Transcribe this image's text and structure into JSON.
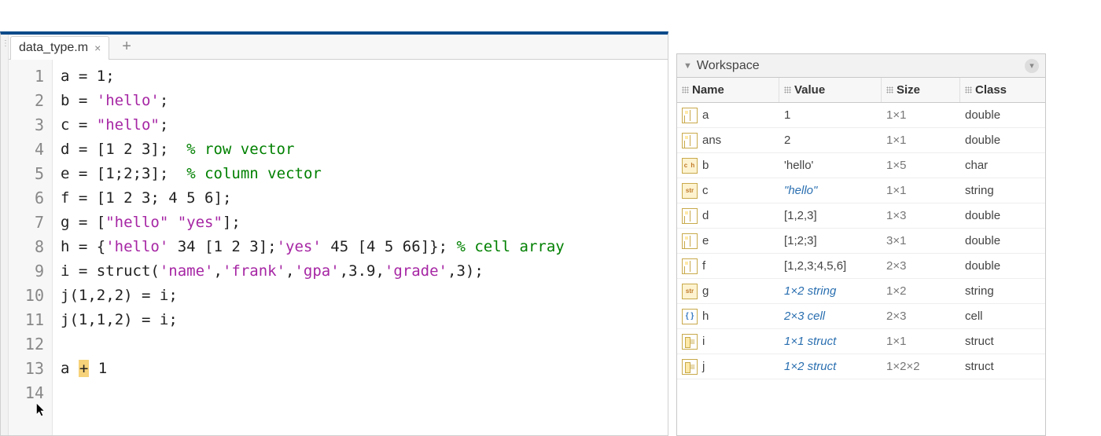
{
  "editor": {
    "tab_name": "data_type.m",
    "lines": [
      [
        {
          "t": "a = "
        },
        {
          "t": "1",
          "c": "s-num"
        },
        {
          "t": ";"
        }
      ],
      [
        {
          "t": "b = "
        },
        {
          "t": "'hello'",
          "c": "s-str1"
        },
        {
          "t": ";"
        }
      ],
      [
        {
          "t": "c = "
        },
        {
          "t": "\"hello\"",
          "c": "s-str2"
        },
        {
          "t": ";"
        }
      ],
      [
        {
          "t": "d = ["
        },
        {
          "t": "1 2 3",
          "c": "s-num"
        },
        {
          "t": "];  "
        },
        {
          "t": "% row vector",
          "c": "s-cmt"
        }
      ],
      [
        {
          "t": "e = ["
        },
        {
          "t": "1",
          "c": "s-num"
        },
        {
          "t": ";"
        },
        {
          "t": "2",
          "c": "s-num"
        },
        {
          "t": ";"
        },
        {
          "t": "3",
          "c": "s-num"
        },
        {
          "t": "];  "
        },
        {
          "t": "% column vector",
          "c": "s-cmt"
        }
      ],
      [
        {
          "t": "f = ["
        },
        {
          "t": "1 2 3",
          "c": "s-num"
        },
        {
          "t": "; "
        },
        {
          "t": "4 5 6",
          "c": "s-num"
        },
        {
          "t": "];"
        }
      ],
      [
        {
          "t": "g = ["
        },
        {
          "t": "\"hello\" \"yes\"",
          "c": "s-str2"
        },
        {
          "t": "];"
        }
      ],
      [
        {
          "t": "h = {"
        },
        {
          "t": "'hello'",
          "c": "s-str1"
        },
        {
          "t": " "
        },
        {
          "t": "34",
          "c": "s-num"
        },
        {
          "t": " ["
        },
        {
          "t": "1 2 3",
          "c": "s-num"
        },
        {
          "t": "];"
        },
        {
          "t": "'yes'",
          "c": "s-str1"
        },
        {
          "t": " "
        },
        {
          "t": "45",
          "c": "s-num"
        },
        {
          "t": " ["
        },
        {
          "t": "4 5 66",
          "c": "s-num"
        },
        {
          "t": "]}; "
        },
        {
          "t": "% cell array",
          "c": "s-cmt"
        }
      ],
      [
        {
          "t": "i = struct("
        },
        {
          "t": "'name'",
          "c": "s-str1"
        },
        {
          "t": ","
        },
        {
          "t": "'frank'",
          "c": "s-str1"
        },
        {
          "t": ","
        },
        {
          "t": "'gpa'",
          "c": "s-str1"
        },
        {
          "t": ","
        },
        {
          "t": "3.9",
          "c": "s-num"
        },
        {
          "t": ","
        },
        {
          "t": "'grade'",
          "c": "s-str1"
        },
        {
          "t": ","
        },
        {
          "t": "3",
          "c": "s-num"
        },
        {
          "t": ");"
        }
      ],
      [
        {
          "t": "j("
        },
        {
          "t": "1",
          "c": "s-num"
        },
        {
          "t": ","
        },
        {
          "t": "2",
          "c": "s-num"
        },
        {
          "t": ","
        },
        {
          "t": "2",
          "c": "s-num"
        },
        {
          "t": ") = i;"
        }
      ],
      [
        {
          "t": "j("
        },
        {
          "t": "1",
          "c": "s-num"
        },
        {
          "t": ","
        },
        {
          "t": "1",
          "c": "s-num"
        },
        {
          "t": ","
        },
        {
          "t": "2",
          "c": "s-num"
        },
        {
          "t": ") = i;"
        }
      ],
      [],
      [
        {
          "t": "a "
        },
        {
          "t": "+",
          "c": "s-cursor"
        },
        {
          "t": " 1"
        }
      ],
      []
    ],
    "line_count": 14
  },
  "workspace": {
    "title": "Workspace",
    "columns": [
      "Name",
      "Value",
      "Size",
      "Class"
    ],
    "rows": [
      {
        "name": "a",
        "icon": "double",
        "value": "1",
        "value_style": "",
        "size": "1×1",
        "class": "double"
      },
      {
        "name": "ans",
        "icon": "double",
        "value": "2",
        "value_style": "",
        "size": "1×1",
        "class": "double"
      },
      {
        "name": "b",
        "icon": "char",
        "value": "'hello'",
        "value_style": "",
        "size": "1×5",
        "class": "char"
      },
      {
        "name": "c",
        "icon": "string",
        "value": "\"hello\"",
        "value_style": "val-italic",
        "size": "1×1",
        "class": "string"
      },
      {
        "name": "d",
        "icon": "double",
        "value": "[1,2,3]",
        "value_style": "",
        "size": "1×3",
        "class": "double"
      },
      {
        "name": "e",
        "icon": "double",
        "value": "[1;2;3]",
        "value_style": "",
        "size": "3×1",
        "class": "double"
      },
      {
        "name": "f",
        "icon": "double",
        "value": "[1,2,3;4,5,6]",
        "value_style": "",
        "size": "2×3",
        "class": "double"
      },
      {
        "name": "g",
        "icon": "string",
        "value": "1×2 string",
        "value_style": "val-italic",
        "size": "1×2",
        "class": "string"
      },
      {
        "name": "h",
        "icon": "cell",
        "value": "2×3 cell",
        "value_style": "val-italic",
        "size": "2×3",
        "class": "cell"
      },
      {
        "name": "i",
        "icon": "struct",
        "value": "1×1 struct",
        "value_style": "val-italic",
        "size": "1×1",
        "class": "struct"
      },
      {
        "name": "j",
        "icon": "struct",
        "value": "1×2 struct",
        "value_style": "val-italic",
        "size": "1×2×2",
        "class": "struct"
      }
    ]
  }
}
